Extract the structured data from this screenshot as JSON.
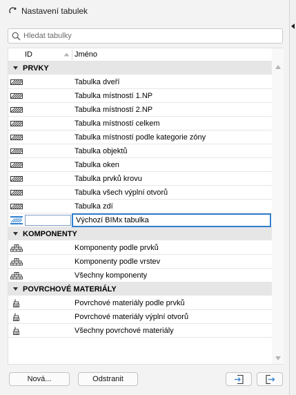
{
  "window": {
    "title": "Nastavení tabulek"
  },
  "search": {
    "placeholder": "Hledat tabulky"
  },
  "columns": {
    "id": "ID",
    "name": "Jméno"
  },
  "groups": [
    {
      "label": "PRVKY",
      "icon": "hatched-table-icon",
      "items": [
        {
          "id": "",
          "name": "Tabulka dveří"
        },
        {
          "id": "",
          "name": "Tabulka místností 1.NP"
        },
        {
          "id": "",
          "name": "Tabulka místností 2.NP"
        },
        {
          "id": "",
          "name": "Tabulka místností celkem"
        },
        {
          "id": "",
          "name": "Tabulka místností podle kategorie zóny"
        },
        {
          "id": "",
          "name": "Tabulka objektů"
        },
        {
          "id": "",
          "name": "Tabulka oken"
        },
        {
          "id": "",
          "name": "Tabulka prvků krovu"
        },
        {
          "id": "",
          "name": "Tabulka všech výplní otvorů"
        },
        {
          "id": "",
          "name": "Tabulka zdí"
        },
        {
          "id": "",
          "name": "Výchozí BIMx tabulka",
          "selected": true
        }
      ]
    },
    {
      "label": "KOMPONENTY",
      "icon": "components-icon",
      "items": [
        {
          "id": "",
          "name": "Komponenty podle prvků"
        },
        {
          "id": "",
          "name": "Komponenty podle vrstev"
        },
        {
          "id": "",
          "name": "Všechny komponenty"
        }
      ]
    },
    {
      "label": "POVRCHOVÉ MATERIÁLY",
      "icon": "paint-brush-icon",
      "items": [
        {
          "id": "",
          "name": "Povrchové materiály podle prvků"
        },
        {
          "id": "",
          "name": "Povrchové materiály výplní otvorů"
        },
        {
          "id": "",
          "name": "Všechny povrchové materiály"
        }
      ]
    }
  ],
  "footer": {
    "new_label": "Nová...",
    "delete_label": "Odstranit",
    "import_icon": "import-icon",
    "export_icon": "export-icon"
  },
  "colors": {
    "selection": "#2f7fd0",
    "group_bg": "#e6e6e6"
  }
}
